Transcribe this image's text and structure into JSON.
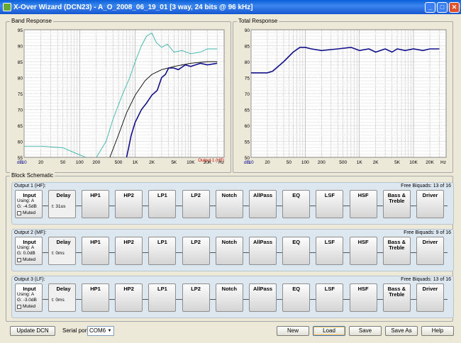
{
  "window": {
    "title": "X-Over Wizard (DCN23) - A_O_2008_06_19_01 [3 way, 24 bits @ 96 kHz]",
    "controls": [
      "_",
      "□",
      "✕"
    ]
  },
  "band_response": {
    "title": "Band Response",
    "legend": "Output 1 (HF)"
  },
  "total_response": {
    "title": "Total Response"
  },
  "chart_data": [
    {
      "type": "line",
      "title": "Band Response",
      "ylim": [
        55,
        95
      ],
      "xscale": "log",
      "xlim": [
        10,
        40000
      ],
      "y_ticks": [
        "95",
        "90",
        "85",
        "80",
        "75",
        "70",
        "65",
        "60",
        "55",
        "dB"
      ],
      "x_ticks": [
        "10",
        "20",
        "50",
        "100",
        "200",
        "500",
        "1K",
        "2K",
        "5K",
        "10K",
        "20K",
        "Hz"
      ],
      "series": [
        {
          "name": "",
          "color": "#39b2a8",
          "x": [
            10,
            20,
            50,
            80,
            100,
            130
          ],
          "y": [
            58.5,
            58.5,
            58,
            56.5,
            55.8,
            55
          ]
        },
        {
          "name": "",
          "color": "#39b2a8",
          "x": [
            200,
            300,
            400,
            600,
            800,
            1000,
            1300,
            1600,
            2000,
            2400,
            3000,
            3800,
            5000,
            7000,
            10000,
            15000,
            20000,
            30000
          ],
          "y": [
            55,
            60,
            67,
            75,
            80,
            85,
            90,
            93,
            94,
            91,
            89.5,
            90.5,
            88,
            88.5,
            87.5,
            88,
            89,
            89
          ]
        },
        {
          "name": "",
          "color": "#000000",
          "x": [
            350,
            500,
            700,
            1000,
            1500,
            2000,
            3000,
            5000,
            10000,
            20000,
            30000
          ],
          "y": [
            55,
            62,
            69,
            74.5,
            79,
            81,
            82.5,
            83.5,
            84.5,
            85,
            85
          ]
        },
        {
          "name": "Output 1 (HF)",
          "color": "#10108a",
          "x": [
            700,
            850,
            1000,
            1300,
            1600,
            2000,
            2500,
            3000,
            3500,
            4000,
            5000,
            6000,
            8000,
            10000,
            15000,
            20000,
            30000
          ],
          "y": [
            55,
            62,
            66,
            70,
            72,
            74.5,
            76,
            80,
            81,
            83,
            83,
            82.5,
            84,
            83.5,
            84.5,
            84,
            84.5
          ]
        }
      ]
    },
    {
      "type": "line",
      "title": "Total Response",
      "ylim": [
        50,
        90
      ],
      "xscale": "log",
      "xlim": [
        10,
        40000
      ],
      "y_ticks": [
        "90",
        "85",
        "80",
        "75",
        "70",
        "65",
        "60",
        "55",
        "50",
        "dB"
      ],
      "x_ticks": [
        "10",
        "20",
        "50",
        "100",
        "200",
        "500",
        "1K",
        "2K",
        "5K",
        "10K",
        "20K",
        "Hz"
      ],
      "series": [
        {
          "name": "",
          "color": "#10108a",
          "x": [
            10,
            20,
            25,
            40,
            60,
            80,
            100,
            130,
            200,
            400,
            700,
            1000,
            1500,
            2000,
            3000,
            4000,
            5000,
            7000,
            10000,
            15000,
            20000,
            30000
          ],
          "y": [
            76.5,
            76.5,
            77,
            80,
            83,
            84.5,
            84.5,
            84,
            83.5,
            84,
            84.5,
            83.5,
            84,
            83,
            84,
            83,
            84,
            83.5,
            84,
            83.5,
            84,
            84
          ]
        }
      ]
    }
  ],
  "block_schematic": {
    "title": "Block Schematic",
    "blocks": [
      "HP1",
      "HP2",
      "LP1",
      "LP2",
      "Notch",
      "AllPass",
      "EQ",
      "LSF",
      "HSF",
      "Bass & Treble",
      "Driver"
    ],
    "outputs": [
      {
        "label": "Output 1 (HF):",
        "biquads": "Free Biquads: 13 of 16",
        "input": "Input",
        "using": "Using: A",
        "gain": "G: -4.5dB",
        "muted": "Muted",
        "delay": "Delay",
        "delay_t": "t: 31us"
      },
      {
        "label": "Output 2 (MF):",
        "biquads": "Free Biquads: 9 of 16",
        "input": "Input",
        "using": "Using: A",
        "gain": "G: 0.0dB",
        "muted": "Muted",
        "delay": "Delay",
        "delay_t": "t: 0ms"
      },
      {
        "label": "Output 3 (LF):",
        "biquads": "Free Biquads: 13 of 16",
        "input": "Input",
        "using": "Using: A",
        "gain": "G: -3.0dB",
        "muted": "Muted",
        "delay": "Delay",
        "delay_t": "t: 0ms"
      }
    ]
  },
  "footer": {
    "update": "Update DCN",
    "serial_label": "Serial port",
    "serial_value": "COM6",
    "new": "New",
    "load": "Load",
    "save": "Save",
    "save_as": "Save As",
    "help": "Help"
  }
}
